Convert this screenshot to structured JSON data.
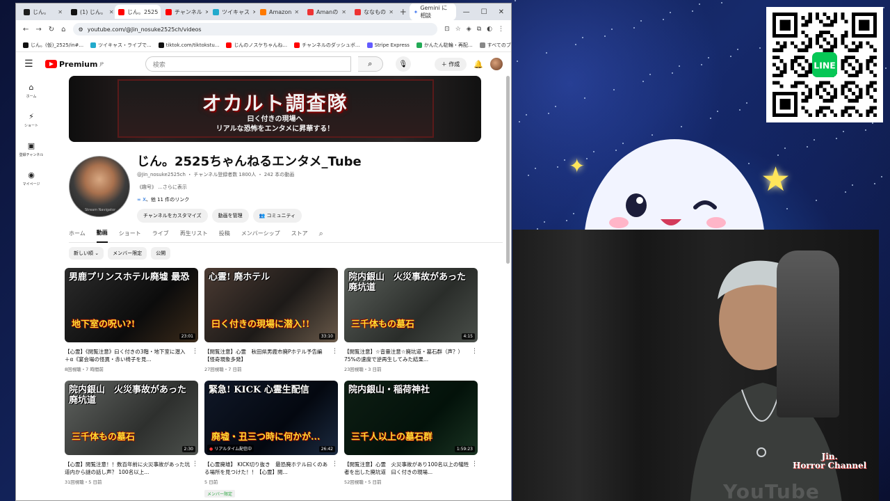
{
  "browser": {
    "tabs": [
      {
        "label": "じん。",
        "color": "#1d1d1d",
        "active": false
      },
      {
        "label": "(1) じん。",
        "color": "#111111",
        "active": false
      },
      {
        "label": "じん。2525",
        "color": "#ff0000",
        "active": true
      },
      {
        "label": "チャンネル",
        "color": "#ff0000",
        "active": false
      },
      {
        "label": "ツイキャス",
        "color": "#22aacc",
        "active": false
      },
      {
        "label": "Amazon",
        "color": "#ff7a00",
        "active": false
      },
      {
        "label": "Amanの",
        "color": "#ee3333",
        "active": false
      },
      {
        "label": "ななもの",
        "color": "#ee3333",
        "active": false
      }
    ],
    "gemini_label": "Gemini に相談",
    "url": "youtube.com/@Jin_nosuke2525ch/videos",
    "bookmarks": [
      {
        "label": "じん。(仮)_2525/in#...",
        "color": "#111111"
      },
      {
        "label": "ツイキャス・ライブで...",
        "color": "#22aacc"
      },
      {
        "label": "tiktok.com/tiktokstu...",
        "color": "#111111"
      },
      {
        "label": "じんのノスケちゃんね...",
        "color": "#ff0000"
      },
      {
        "label": "チャンネルのダッシュボ...",
        "color": "#ff0000"
      },
      {
        "label": "Stripe Express",
        "color": "#635bff"
      },
      {
        "label": "かんたん駐輪・再配...",
        "color": "#22aa55"
      },
      {
        "label": "すべてのブックマーク",
        "color": "#888888"
      }
    ]
  },
  "youtube": {
    "logo": "Premium",
    "logo_sup": "JP",
    "search_placeholder": "検索",
    "create_label": "作成",
    "sidebar": [
      {
        "label": "ホーム",
        "icon": "home-icon",
        "glyph": "⌂"
      },
      {
        "label": "ショート",
        "icon": "shorts-icon",
        "glyph": "⚡"
      },
      {
        "label": "登録チャンネル",
        "icon": "subscriptions-icon",
        "glyph": "▣"
      },
      {
        "label": "マイページ",
        "icon": "my-page-icon",
        "glyph": "◉"
      }
    ],
    "banner": {
      "title": "オカルト調査隊",
      "line1": "曰く付きの現場へ",
      "line2": "リアルな恐怖をエンタメに昇華する！"
    },
    "channel": {
      "name": "じん。2525ちゃんねるエンタメ_Tube",
      "handle": "@Jin_nosuke2525ch",
      "subs": "チャンネル登録者数 1800人",
      "videos": "242 本の動画",
      "desc": "《趣号》 ...さらに表示",
      "links_prefix": "X",
      "links_rest": "、他 11 件のリンク",
      "avatar_text": "Stream Navigator",
      "buttons": [
        "チャンネルをカスタマイズ",
        "動画を管理",
        "コミュニティ"
      ]
    },
    "tabs": [
      "ホーム",
      "動画",
      "ショート",
      "ライブ",
      "再生リスト",
      "投稿",
      "メンバーシップ",
      "ストア"
    ],
    "chips": [
      "新しい順",
      "メンバー限定",
      "公開"
    ],
    "videos": [
      {
        "thumb_title": "男鹿プリンスホテル廃墟 最恐",
        "thumb_sub": "地下室の呪い?!",
        "bg": "linear-gradient(135deg,#2b2b2b,#0c0c0c 60%,#3a2a1a)",
        "duration": "23:01",
        "title": "【心霊】《閲覧注意》曰く付きの3階・地下室に潜入＋α《宴会場の怪異・赤い椅子を見...",
        "meta": "8回視聴・7 時間前",
        "member": false,
        "live": false
      },
      {
        "thumb_title": "心霊! 廃ホテル",
        "thumb_sub": "曰く付きの現場に潜入!!",
        "bg": "linear-gradient(135deg,#4a3a32,#1d1a18 55%,#6a5a4a)",
        "duration": "33:10",
        "title": "【閲覧注意】心霊　秋田県男鹿市廃Pホテル予告編 【怪奇現象多発】",
        "meta": "27回視聴・7 日前",
        "member": false,
        "live": false
      },
      {
        "thumb_title": "院内銀山　火災事故があった廃坑道",
        "thumb_sub": "三千体もの墓石",
        "bg": "linear-gradient(135deg,#5a5f5a,#2a2d2a 60%,#4a4f4a)",
        "duration": "4:15",
        "title": "【閲覧注意】☆音量注意☆廃坑道・墓石群（声？）75%の速度で逆再生してみた結果...",
        "meta": "23回視聴・3 日前",
        "member": false,
        "live": false
      },
      {
        "thumb_title": "院内銀山　火災事故があった廃坑道",
        "thumb_sub": "三千体もの墓石",
        "bg": "linear-gradient(135deg,#5f625f,#2e302e 60%,#4c504c)",
        "duration": "2:30",
        "title": "【心霊】閲覧注意！！数百年前に火災事故があった坑道内から謎の話し声？ 100名以上...",
        "meta": "31回視聴・5 日前",
        "member": false,
        "live": false
      },
      {
        "thumb_title": "緊急! KICK 心霊生配信",
        "thumb_sub": "廃墟・丑三つ時に何かが...",
        "bg": "linear-gradient(135deg,#101828,#040810 60%,#1b2a40)",
        "duration": "26:42",
        "title": "【心霊廃墟】 KICK切り抜き　最恐廃ホテル曰くのある場所を見つけた！！【心霊】閲...",
        "meta": "5 日前",
        "member": true,
        "member_label": "メンバー限定",
        "live": true,
        "live_label": "リアルタイム配信中"
      },
      {
        "thumb_title": "院内銀山・稲荷神社",
        "thumb_sub": "三千人以上の墓石群",
        "bg": "linear-gradient(135deg,#0e1e14,#03120a 60%,#1a3322)",
        "duration": "1:59:23",
        "title": "【閲覧注意】心霊　火災事故があり100名以上の犠牲者を出した廃坑道　曰く付きの現場...",
        "meta": "52回視聴・5 日前",
        "member": false,
        "live": false
      }
    ]
  },
  "overlay": {
    "watermark_line1": "Jin.",
    "watermark_line2": "Horror Channel",
    "yt_watermark": "YouTube"
  },
  "colors": {
    "accent": "#ff0000",
    "link": "#065fd4"
  }
}
